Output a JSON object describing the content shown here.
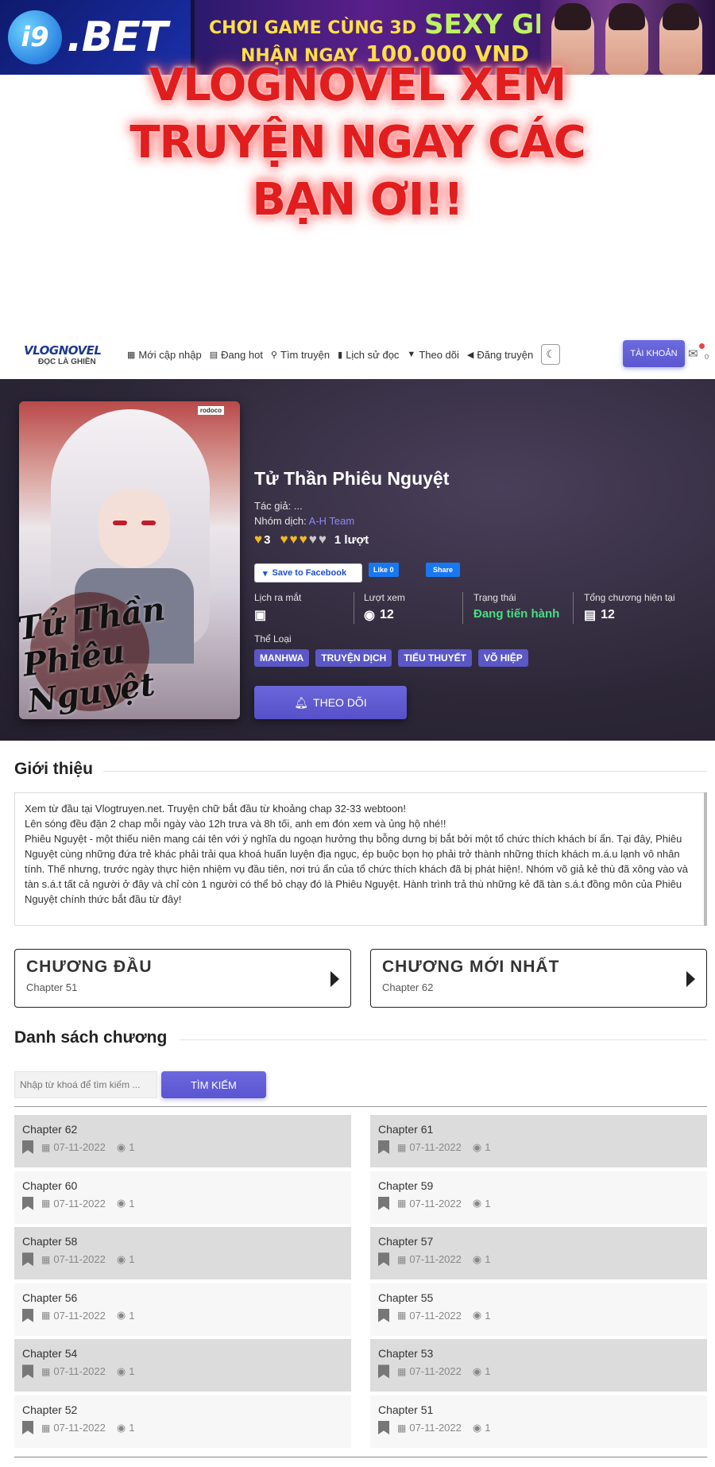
{
  "ad": {
    "logo_badge": "i9",
    "logo_text": ".BET",
    "line1a": "CHƠI GAME CÙNG 3D",
    "line1b": "SEXY GIRL",
    "line2a": "NHẬN NGAY",
    "line2b": "100.000 VND"
  },
  "promo": {
    "line1": "VLOGNOVEL XEM",
    "line2": "TRUYỆN NGAY CÁC",
    "line3": "BẠN ƠI!!"
  },
  "nav": {
    "brand_top": "VLOGNOVEL",
    "brand_bottom": "ĐỌC LÀ GHIỀN",
    "items": [
      {
        "label": "Mới cập nhập",
        "icon": "grid-icon"
      },
      {
        "label": "Đang hot",
        "icon": "list-icon"
      },
      {
        "label": "Tìm truyện",
        "icon": "search-icon"
      },
      {
        "label": "Lịch sử đọc",
        "icon": "book-icon"
      },
      {
        "label": "Theo dõi",
        "icon": "bookmark-icon"
      },
      {
        "label": "Đăng truyện",
        "icon": "megaphone-icon"
      }
    ],
    "account": "TÀI KHOẢN",
    "notification_count": "0"
  },
  "manga": {
    "title": "Tử Thần Phiêu Nguyệt",
    "cover_brand": "rodoco",
    "cover_title": "Tử Thần Phiêu Nguyệt",
    "author_label": "Tác giả: ...",
    "group_label": "Nhóm dịch:",
    "group_value": "A-H Team",
    "rating_score": "3",
    "rating_hearts_filled": 3,
    "rating_hearts_total": 5,
    "rating_votes": "1 lượt",
    "fb_save": "Save to Facebook",
    "fb_like": "Like 0",
    "fb_share": "Share",
    "stats": {
      "release_label": "Lịch ra mắt",
      "views_label": "Lượt xem",
      "views_value": "12",
      "status_label": "Trạng thái",
      "status_value": "Đang tiến hành",
      "chapters_label": "Tổng chương hiện tại",
      "chapters_value": "12"
    },
    "genre_label": "Thể Loại",
    "genres": [
      "MANHWA",
      "TRUYỆN DỊCH",
      "TIỂU THUYẾT",
      "VÕ HIỆP"
    ],
    "follow": "THEO DÕI"
  },
  "intro": {
    "title": "Giới thiệu",
    "p1": "Xem từ đầu tại Vlogtruyen.net. Truyện chữ bắt đầu từ khoảng chap 32-33 webtoon!",
    "p2": "Lên sóng đều đặn 2 chap mỗi ngày vào 12h trưa và 8h tối, anh em đón xem và ủng hộ nhé!!",
    "p3": "Phiêu Nguyệt - một thiếu niên mang cái tên với ý nghĩa du ngoạn hưởng thụ bỗng dưng bị bắt bởi một tổ chức thích khách bí ẩn. Tại đây, Phiêu Nguyệt cùng những đứa trẻ khác phải trải qua khoá huấn luyện địa ngục, ép buộc bọn họ phải trở thành những thích khách m.á.u lạnh vô nhân tính. Thế nhưng, trước ngày thực hiện nhiệm vụ đầu tiên, nơi trú ẩn của tổ chức thích khách đã bị phát hiện!. Nhóm võ giả kẻ thù đã xông vào và tàn s.á.t tất cả người ở đây và chỉ còn 1 người có thể bỏ chạy đó là Phiêu Nguyệt. Hành trình trả thù những kẻ đã tàn s.á.t đồng môn của Phiêu Nguyệt chính thức bắt đầu từ đây!"
  },
  "first_chapter": {
    "title": "CHƯƠNG ĐẦU",
    "sub": "Chapter 51"
  },
  "latest_chapter": {
    "title": "CHƯƠNG MỚI NHẤT",
    "sub": "Chapter 62"
  },
  "chapter_list": {
    "title": "Danh sách chương",
    "search_placeholder": "Nhập từ khoá để tìm kiếm ...",
    "search_button": "TÌM KIẾM",
    "chapters": [
      {
        "name": "Chapter 62",
        "date": "07-11-2022",
        "views": "1"
      },
      {
        "name": "Chapter 61",
        "date": "07-11-2022",
        "views": "1"
      },
      {
        "name": "Chapter 60",
        "date": "07-11-2022",
        "views": "1"
      },
      {
        "name": "Chapter 59",
        "date": "07-11-2022",
        "views": "1"
      },
      {
        "name": "Chapter 58",
        "date": "07-11-2022",
        "views": "1"
      },
      {
        "name": "Chapter 57",
        "date": "07-11-2022",
        "views": "1"
      },
      {
        "name": "Chapter 56",
        "date": "07-11-2022",
        "views": "1"
      },
      {
        "name": "Chapter 55",
        "date": "07-11-2022",
        "views": "1"
      },
      {
        "name": "Chapter 54",
        "date": "07-11-2022",
        "views": "1"
      },
      {
        "name": "Chapter 53",
        "date": "07-11-2022",
        "views": "1"
      },
      {
        "name": "Chapter 52",
        "date": "07-11-2022",
        "views": "1"
      },
      {
        "name": "Chapter 51",
        "date": "07-11-2022",
        "views": "1"
      }
    ]
  },
  "colors": {
    "accent": "#5b57c7",
    "status_green": "#4ade80",
    "heart_gold": "#f5b91e",
    "promo_red": "#e11d1d"
  }
}
